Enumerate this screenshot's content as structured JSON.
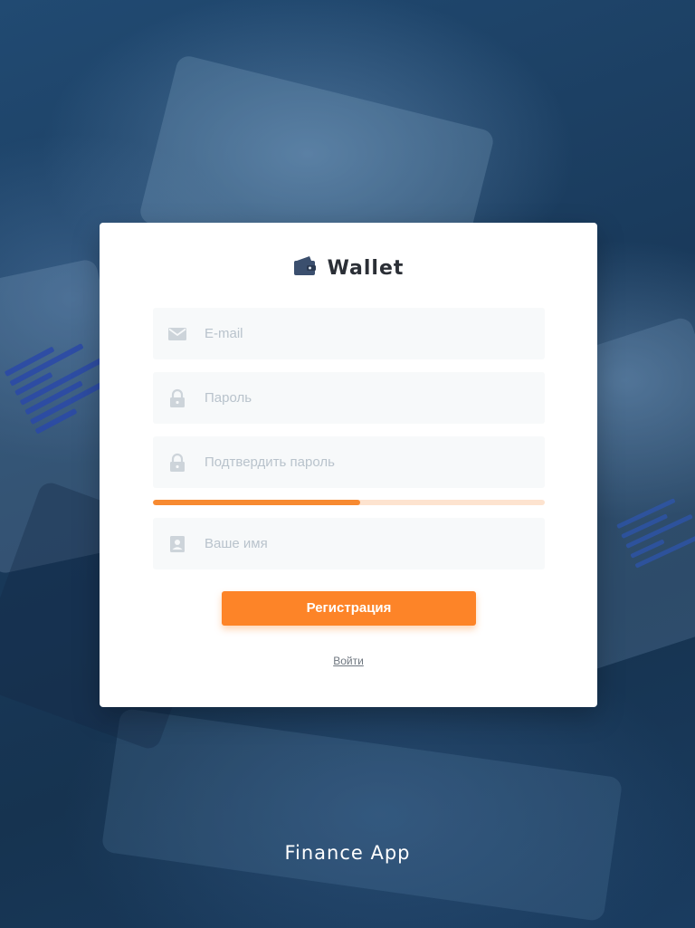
{
  "brand": {
    "name": "Wallet",
    "icon": "wallet-icon",
    "icon_color": "#3b4f6e"
  },
  "form": {
    "email": {
      "placeholder": "E-mail",
      "value": "",
      "icon": "mail-icon"
    },
    "password": {
      "placeholder": "Пароль",
      "value": "",
      "icon": "lock-icon"
    },
    "confirm_password": {
      "placeholder": "Подтвердить пароль",
      "value": "",
      "icon": "lock-icon"
    },
    "strength": {
      "fraction": 0.53,
      "color": "#f78a31",
      "track_color": "#fde3cf"
    },
    "name": {
      "placeholder": "Ваше имя",
      "value": "",
      "icon": "contact-card-icon"
    }
  },
  "actions": {
    "register_label": "Регистрация",
    "login_link": "Войти"
  },
  "footer": {
    "app_name": "Finance App"
  },
  "colors": {
    "accent": "#fd8428",
    "background": "#1d4368",
    "field_bg": "#f7f9fa",
    "placeholder": "#b9c3cc"
  }
}
